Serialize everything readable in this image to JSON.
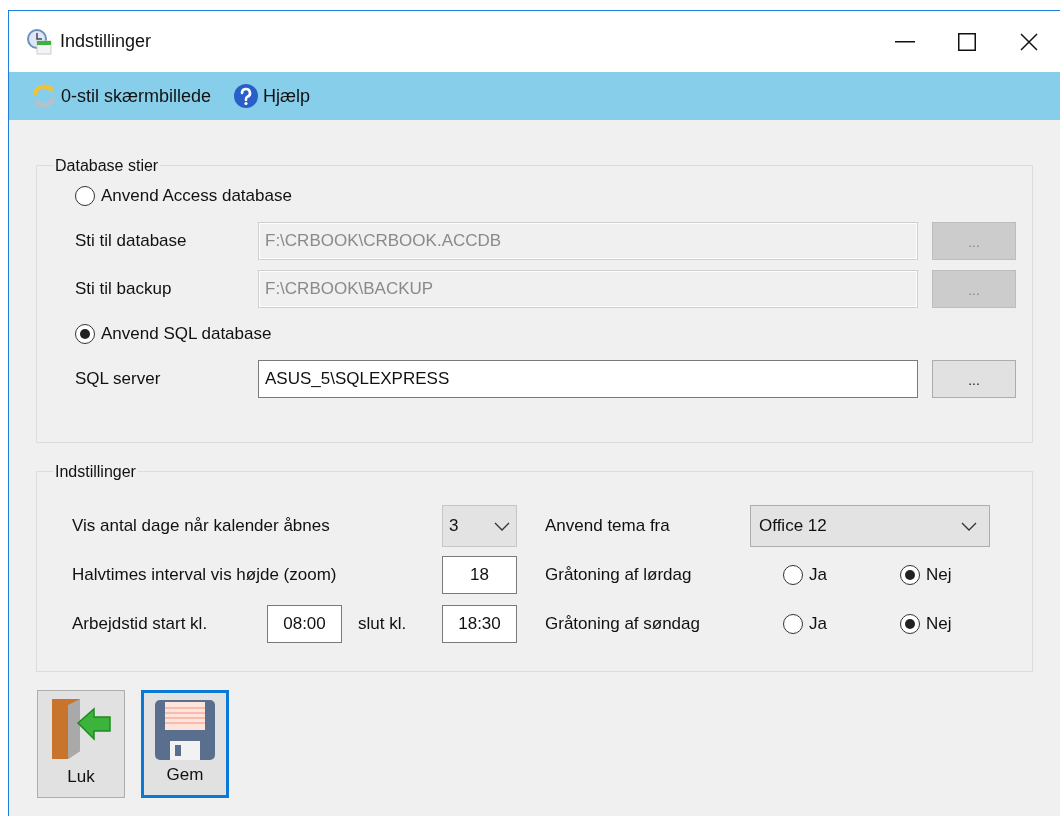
{
  "window": {
    "title": "Indstillinger"
  },
  "toolbar": [
    {
      "kind": "reset",
      "label": "0-stil skærmbillede"
    },
    {
      "kind": "help",
      "label": "Hjælp"
    }
  ],
  "database": {
    "title": "Database stier",
    "rows": [
      {
        "kind": "radio",
        "label": "Anvend Access database",
        "selected": false
      },
      {
        "kind": "path",
        "label": "Sti til database",
        "value": "F:\\CRBOOK\\CRBOOK.ACCDB",
        "disabled": true,
        "button": "..."
      },
      {
        "kind": "path",
        "label": "Sti til backup",
        "value": "F:\\CRBOOK\\BACKUP",
        "disabled": true,
        "button": "..."
      },
      {
        "kind": "radio",
        "label": "Anvend SQL database",
        "selected": true
      },
      {
        "kind": "path",
        "label": "SQL server",
        "value": "ASUS_5\\SQLEXPRESS",
        "disabled": false,
        "button": "..."
      }
    ]
  },
  "settings": {
    "title": "Indstillinger",
    "days": {
      "label": "Vis antal dage når kalender åbnes",
      "value": "3"
    },
    "zoom": {
      "label": "Halvtimes interval vis højde (zoom)",
      "value": "18"
    },
    "worktime": {
      "label": "Arbejdstid start kl.",
      "start": "08:00",
      "end_label": "slut kl.",
      "end": "18:30"
    },
    "theme": {
      "label": "Anvend tema fra",
      "value": "Office 12"
    },
    "greyout": [
      {
        "label": "Gråtoning af lørdag",
        "options": [
          {
            "label": "Ja",
            "selected": false
          },
          {
            "label": "Nej",
            "selected": true
          }
        ]
      },
      {
        "label": "Gråtoning af søndag",
        "options": [
          {
            "label": "Ja",
            "selected": false
          },
          {
            "label": "Nej",
            "selected": true
          }
        ]
      }
    ]
  },
  "buttons": [
    {
      "kind": "exit",
      "label": "Luk",
      "focused": false
    },
    {
      "kind": "save",
      "label": "Gem",
      "focused": true
    }
  ]
}
